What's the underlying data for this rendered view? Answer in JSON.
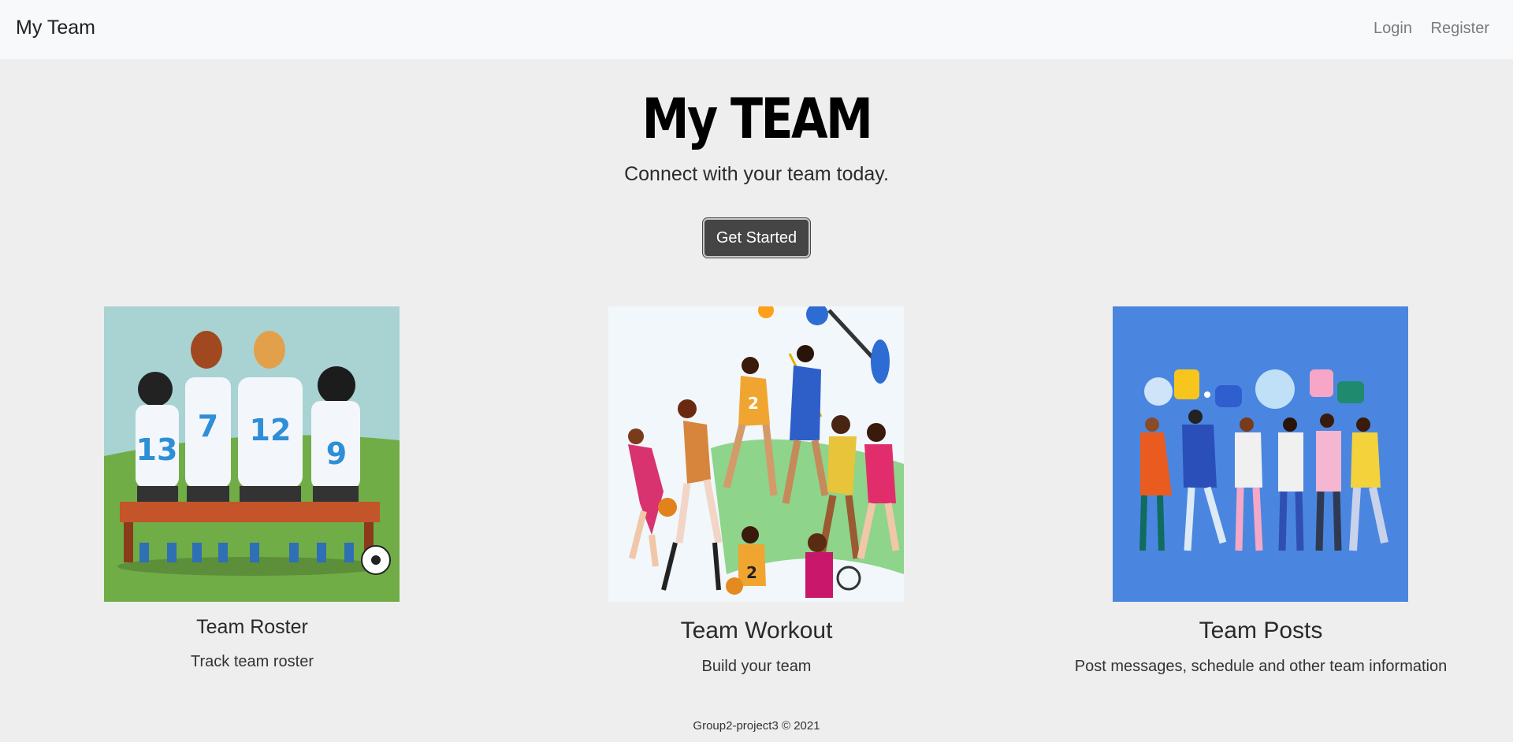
{
  "navbar": {
    "brand": "My Team",
    "links": [
      {
        "label": "Login"
      },
      {
        "label": "Register"
      }
    ]
  },
  "hero": {
    "title": "My TEAM",
    "subtitle": "Connect with your team today.",
    "cta_label": "Get Started"
  },
  "cards": [
    {
      "title": "Team Roster",
      "description": "Track team roster",
      "jersey_numbers": [
        "13",
        "7",
        "12",
        "9"
      ]
    },
    {
      "title": "Team Workout",
      "description": "Build your team",
      "jersey_numbers": [
        "2",
        "2"
      ]
    },
    {
      "title": "Team Posts",
      "description": "Post messages, schedule and other team information"
    }
  ],
  "footer": {
    "text": "Group2-project3 © 2021"
  },
  "colors": {
    "page_bg": "#eeeeee",
    "navbar_bg": "#f8f9fa",
    "button_bg": "#454545",
    "posts_bg": "#4a86e0",
    "roster_sky": "#a8d3d2",
    "roster_grass": "#70ad47"
  }
}
